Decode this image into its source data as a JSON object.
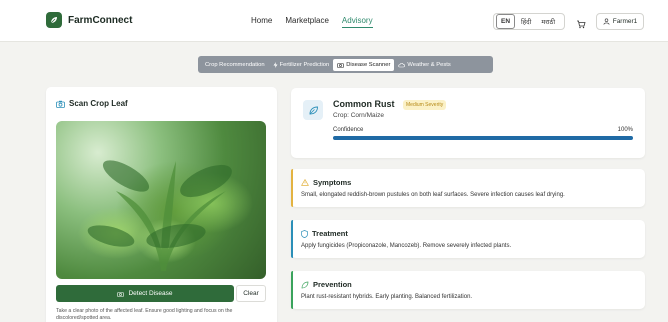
{
  "brand": {
    "name": "FarmConnect"
  },
  "nav": {
    "home": "Home",
    "marketplace": "Marketplace",
    "advisory": "Advisory"
  },
  "languages": [
    "EN",
    "हिंदी",
    "मराठी"
  ],
  "user": {
    "name": "Farmer1"
  },
  "tabs": [
    {
      "label": "Crop Recommendation"
    },
    {
      "label": "Fertilizer Prediction"
    },
    {
      "label": "Disease Scanner"
    },
    {
      "label": "Weather & Pests"
    }
  ],
  "scan": {
    "title": "Scan Crop Leaf",
    "detect_label": "Detect Disease",
    "clear_label": "Clear",
    "hint": "Take a clear photo of the affected leaf. Ensure good lighting and focus on the discolored/spotted area."
  },
  "result": {
    "disease": "Common Rust",
    "severity": "Medium Severity",
    "crop": "Crop: Corn/Maize",
    "confidence_label": "Confidence",
    "confidence_value": "100%",
    "confidence_fraction": 1.0
  },
  "symptoms": {
    "title": "Symptoms",
    "text": "Small, elongated reddish-brown pustules on both leaf surfaces. Severe infection causes leaf drying."
  },
  "treatment": {
    "title": "Treatment",
    "text": "Apply fungicides (Propiconazole, Mancozeb). Remove severely infected plants."
  },
  "prevention": {
    "title": "Prevention",
    "text": "Plant rust-resistant hybrids. Early planting. Balanced fertilization."
  },
  "colors": {
    "primary": "#2f6b3a",
    "accent": "#2f8a6d",
    "confidence": "#1f6aa5",
    "symptoms": "#e3b341",
    "treatment": "#2b8fb8",
    "prevention": "#3aa35c"
  }
}
